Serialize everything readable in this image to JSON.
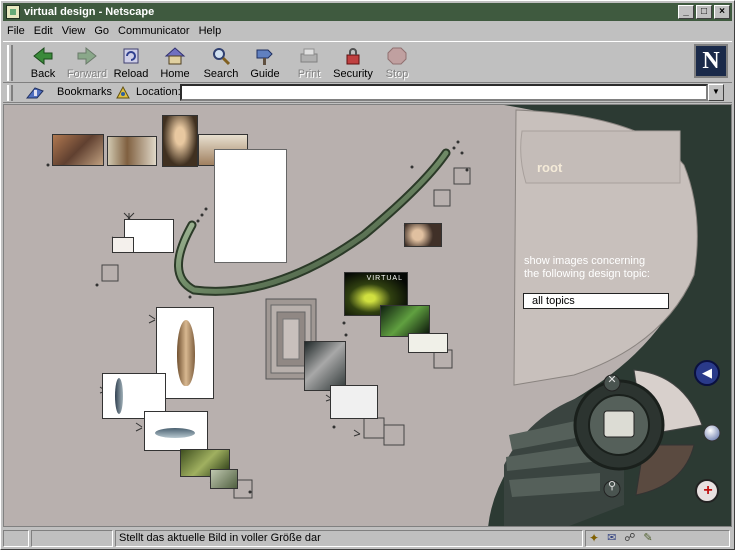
{
  "window": {
    "title": "virtual design - Netscape"
  },
  "menu": [
    "File",
    "Edit",
    "View",
    "Go",
    "Communicator",
    "Help"
  ],
  "toolbar": [
    {
      "label": "Back",
      "icon": "back-arrow-icon",
      "enabled": true
    },
    {
      "label": "Forward",
      "icon": "forward-arrow-icon",
      "enabled": false
    },
    {
      "label": "Reload",
      "icon": "reload-icon",
      "enabled": true
    },
    {
      "label": "Home",
      "icon": "home-icon",
      "enabled": true
    },
    {
      "label": "Search",
      "icon": "search-icon",
      "enabled": true
    },
    {
      "label": "Guide",
      "icon": "guide-icon",
      "enabled": true
    },
    {
      "label": "Print",
      "icon": "print-icon",
      "enabled": false
    },
    {
      "label": "Security",
      "icon": "security-lock-icon",
      "enabled": true
    },
    {
      "label": "Stop",
      "icon": "stop-icon",
      "enabled": false
    }
  ],
  "location_bar": {
    "bookmarks_label": "Bookmarks",
    "location_label": "Location:",
    "url": ""
  },
  "page": {
    "node_label": "root",
    "topic_prompt_line1": "show images concerning",
    "topic_prompt_line2": "the following design topic:",
    "topic_selected": "all topics",
    "thumb_caption": "VIRTUAL"
  },
  "status": {
    "message": "Stellt das aktuelle Bild in voller Größe dar"
  },
  "colors": {
    "title_bg": "#3f5a3f",
    "content_bg": "#b8b0ae",
    "panel_dark": "#2c3a33",
    "panel_light": "#c8c0bc"
  }
}
